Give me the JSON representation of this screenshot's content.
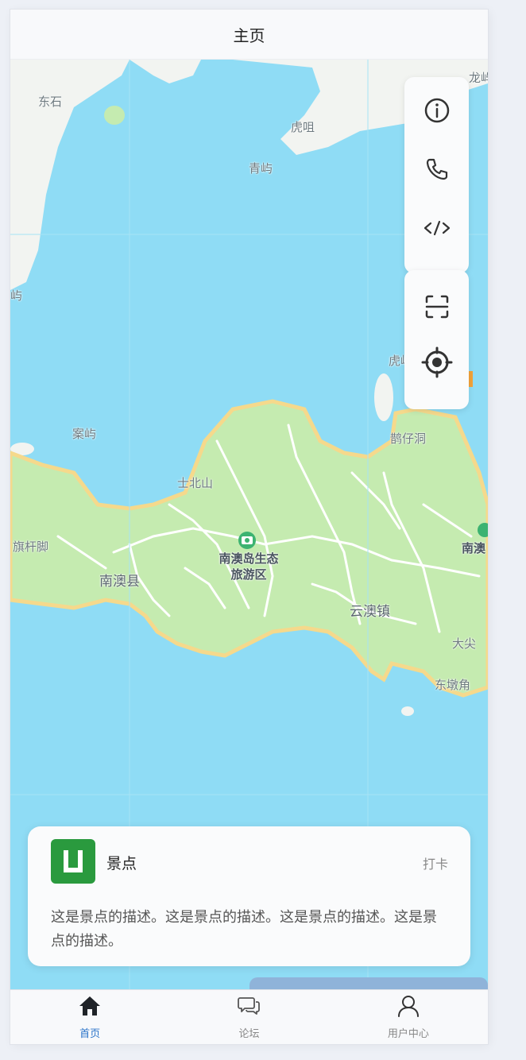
{
  "header": {
    "title": "主页"
  },
  "map": {
    "labels": {
      "dongshi": "东石",
      "huju": "虎咀",
      "qingyu": "青屿",
      "long": "龙屿",
      "yu": "屿",
      "hu": "虎屿",
      "anyu": "案屿",
      "shibeishan": "士北山",
      "queizaidong": "鹊仔洞",
      "qiganjiao": "旗杆脚",
      "nanaoxian": "南澳县",
      "poi": "南澳岛生态\n旅游区",
      "yunaozhen": "云澳镇",
      "nanao_right": "南澳",
      "dajian": "大尖",
      "dongdunjiao": "东墩角"
    },
    "colors": {
      "water": "#8fdcf5",
      "land": "#c5ebb0",
      "mainland": "#f2f4f1",
      "road": "#f5d98c"
    }
  },
  "toolbar": {
    "icons": [
      "info-icon",
      "phone-icon",
      "code-icon",
      "scan-icon",
      "locate-icon"
    ]
  },
  "card": {
    "title": "景点",
    "action": "打卡",
    "description": "这是景点的描述。这是景点的描述。这是景点的描述。这是景点的描述。",
    "logo_color": "#2a9a3e"
  },
  "tabs": [
    {
      "label": "首页",
      "icon": "home-icon",
      "active": true
    },
    {
      "label": "论坛",
      "icon": "chat-icon",
      "active": false
    },
    {
      "label": "用户中心",
      "icon": "user-icon",
      "active": false
    }
  ]
}
